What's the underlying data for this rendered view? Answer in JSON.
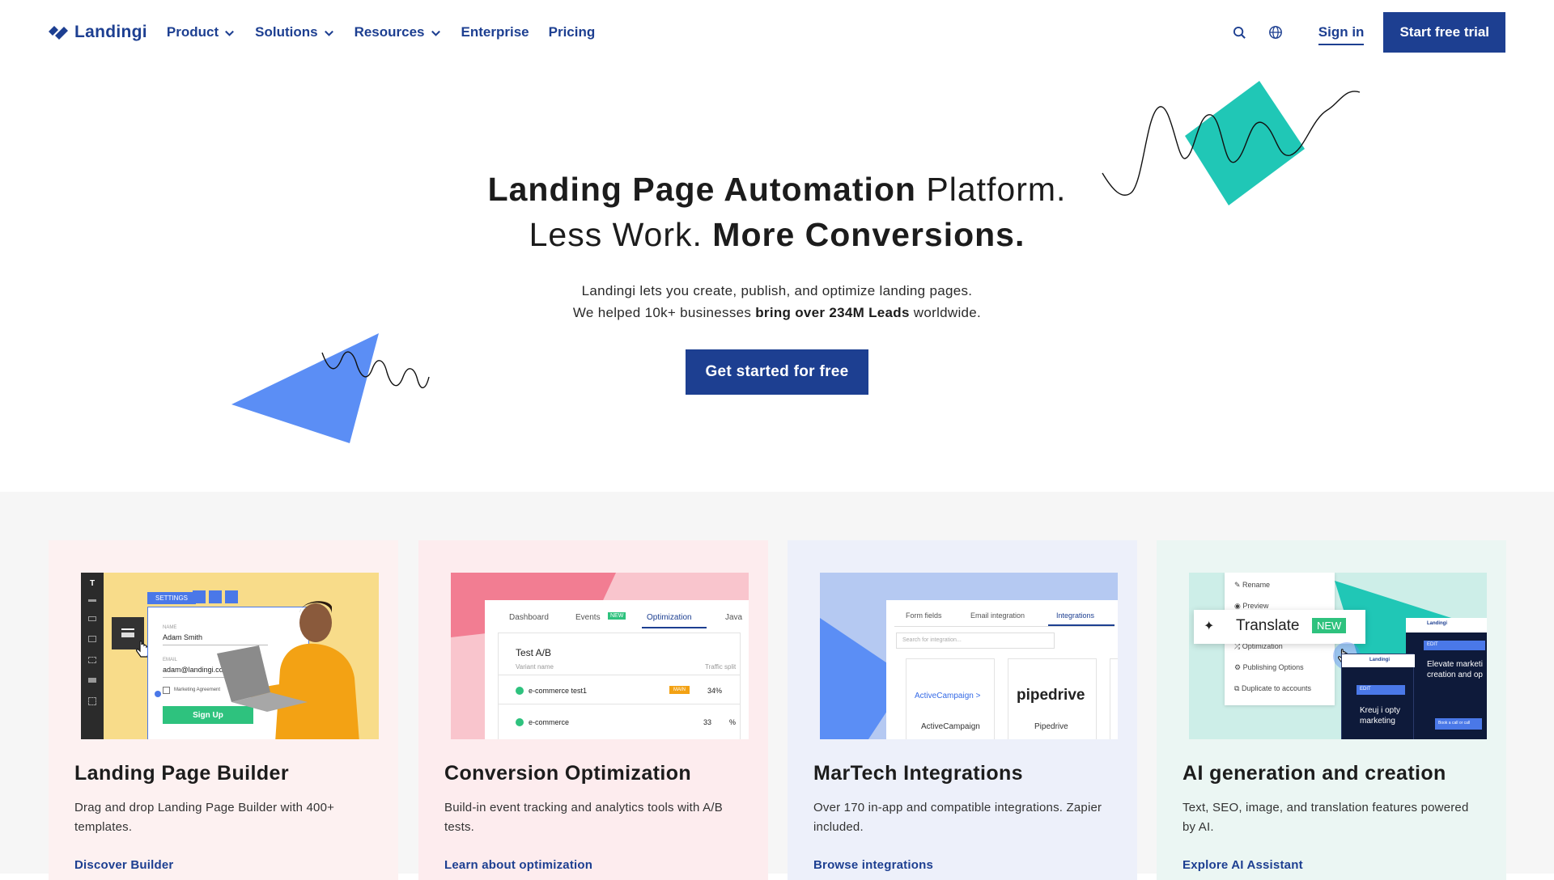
{
  "nav": {
    "logo_text": "Landingi",
    "items": [
      {
        "label": "Product",
        "dropdown": true
      },
      {
        "label": "Solutions",
        "dropdown": true
      },
      {
        "label": "Resources",
        "dropdown": true
      },
      {
        "label": "Enterprise",
        "dropdown": false
      },
      {
        "label": "Pricing",
        "dropdown": false
      }
    ],
    "signin": "Sign in",
    "trial": "Start free trial"
  },
  "hero": {
    "title_bold_1": "Landing Page Automation",
    "title_light_1": " Platform.",
    "title_light_2": "Less Work. ",
    "title_bold_2": "More Conversions.",
    "sub_line_1": "Landingi lets you create, publish, and optimize landing pages.",
    "sub_line_2_pre": "We helped 10k+ businesses ",
    "sub_line_2_bold": "bring over 234M Leads",
    "sub_line_2_post": " worldwide.",
    "cta": "Get started for free"
  },
  "colors": {
    "brand": "#1d3f91",
    "teal": "#20c7b6",
    "blue_shape": "#5b8ef5"
  },
  "cards": [
    {
      "title": "Landing Page Builder",
      "desc": "Drag and drop Landing Page Builder with 400+ templates.",
      "link": "Discover Builder",
      "bg": "#fdf1f1",
      "mock": {
        "toolbar": "SETTINGS",
        "name_label": "NAME",
        "name_value": "Adam Smith",
        "email_label": "EMAIL",
        "email_value": "adam@landingi.com",
        "checkbox": "Marketing Agreement",
        "button": "Sign Up"
      }
    },
    {
      "title": "Conversion Optimization",
      "desc": "Build-in event tracking and analytics tools with A/B tests.",
      "link": "Learn about optimization",
      "bg": "#fdecee",
      "mock": {
        "tabs": [
          "Dashboard",
          "Events",
          "Optimization",
          "Java"
        ],
        "new_badge": "NEW",
        "test_name": "Test A/B",
        "col_variant": "Variant name",
        "col_split": "Traffic split",
        "rows": [
          {
            "name": "e-commerce test1",
            "badge": "MAIN",
            "split": "34%"
          },
          {
            "name": "e-commerce",
            "split": "33"
          }
        ],
        "pct": "%"
      }
    },
    {
      "title": "MarTech Integrations",
      "desc": "Over 170 in-app and compatible integrations. Zapier included.",
      "link": "Browse integrations",
      "bg": "#edf0fa",
      "mock": {
        "tabs": [
          "Form fields",
          "Email integration",
          "Integrations"
        ],
        "search": "Search for integration...",
        "apps": [
          {
            "logo": "ActiveCampaign >",
            "name": "ActiveCampaign"
          },
          {
            "logo": "pipedrive",
            "name": "Pipedrive"
          }
        ]
      }
    },
    {
      "title": "AI generation and creation",
      "desc": "Text, SEO, image, and translation features powered by AI.",
      "link": "Explore AI Assistant",
      "bg": "#ebf6f3",
      "mock": {
        "menu": [
          "Rename",
          "Preview",
          "Optimization",
          "Publishing Options",
          "Duplicate to accounts"
        ],
        "translate": "Translate",
        "new_badge": "NEW",
        "brand": "Landingi",
        "edit": "EDIT",
        "preview_text_1": "Elevate marketi",
        "preview_text_2": "creation and op",
        "preview_text_3": "Kreuj i opty",
        "preview_text_4": "marketing",
        "cta_small": "Book a call or call"
      }
    }
  ]
}
